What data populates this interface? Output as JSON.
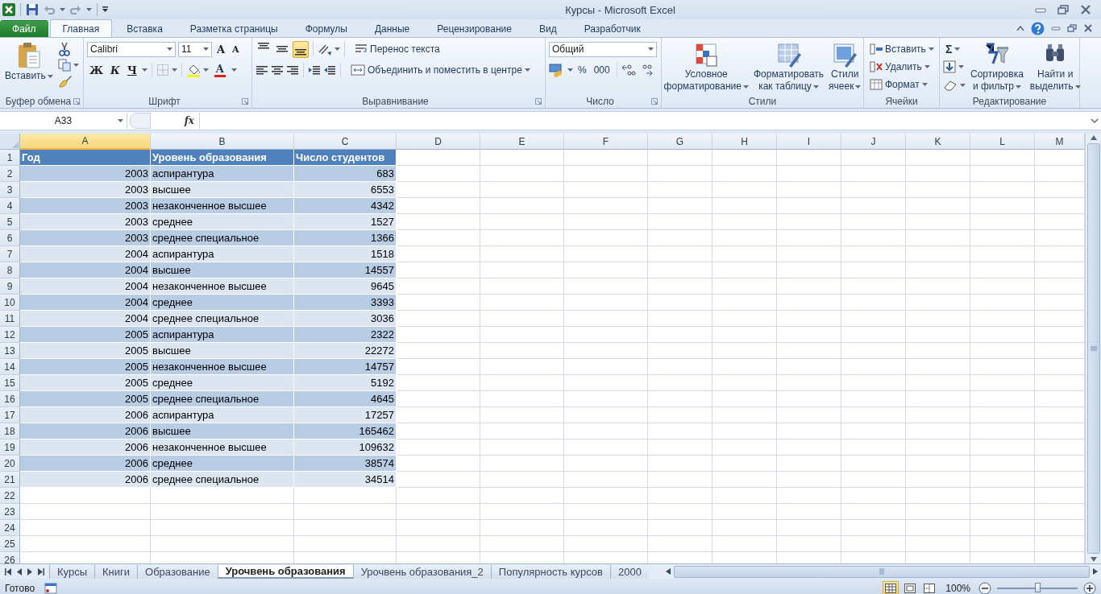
{
  "title_bar": {
    "title": "Курсы  -  Microsoft Excel"
  },
  "ribbon_tabs": [
    {
      "label": "Файл",
      "kind": "file",
      "selected": false
    },
    {
      "label": "Главная",
      "kind": "tab",
      "selected": true
    },
    {
      "label": "Вставка",
      "kind": "tab",
      "selected": false
    },
    {
      "label": "Разметка страницы",
      "kind": "tab",
      "selected": false
    },
    {
      "label": "Формулы",
      "kind": "tab",
      "selected": false
    },
    {
      "label": "Данные",
      "kind": "tab",
      "selected": false
    },
    {
      "label": "Рецензирование",
      "kind": "tab",
      "selected": false
    },
    {
      "label": "Вид",
      "kind": "tab",
      "selected": false
    },
    {
      "label": "Разработчик",
      "kind": "tab",
      "selected": false
    }
  ],
  "ribbon": {
    "clipboard": {
      "label": "Буфер обмена",
      "paste": "Вставить"
    },
    "font": {
      "label": "Шрифт",
      "font_name": "Calibri",
      "font_size": "11",
      "grow_font": "A",
      "shrink_font": "A",
      "bold": "Ж",
      "italic": "К",
      "underline": "Ч",
      "font_color": "A"
    },
    "alignment": {
      "label": "Выравнивание",
      "vertical_align": [
        {
          "selected": false
        },
        {
          "selected": false
        },
        {
          "selected": true
        }
      ],
      "wrap_text": "Перенос текста",
      "merge_center": "Объединить и поместить в центре"
    },
    "number": {
      "label": "Число",
      "format": "Общий",
      "percent": "%",
      "thousands": "000"
    },
    "styles": {
      "label": "Стили",
      "buttons": [
        {
          "lines": [
            "Условное",
            "форматирование"
          ]
        },
        {
          "lines": [
            "Форматировать",
            "как таблицу"
          ]
        },
        {
          "lines": [
            "Стили",
            "ячеек"
          ]
        }
      ]
    },
    "cells": {
      "label": "Ячейки",
      "buttons": [
        "Вставить",
        "Удалить",
        "Формат"
      ]
    },
    "editing": {
      "label": "Редактирование",
      "sum": "Σ",
      "buttons": [
        {
          "lines": [
            "Сортировка",
            "и фильтр"
          ]
        },
        {
          "lines": [
            "Найти и",
            "выделить"
          ]
        }
      ]
    }
  },
  "formula_bar": {
    "name_box": "A33",
    "function_label": "fx"
  },
  "columns": [
    {
      "label": "A",
      "selected": true
    },
    {
      "label": "B",
      "selected": false
    },
    {
      "label": "C",
      "selected": false
    },
    {
      "label": "D",
      "selected": false
    },
    {
      "label": "E",
      "selected": false
    },
    {
      "label": "F",
      "selected": false
    },
    {
      "label": "G",
      "selected": false
    },
    {
      "label": "H",
      "selected": false
    },
    {
      "label": "I",
      "selected": false
    },
    {
      "label": "J",
      "selected": false
    },
    {
      "label": "K",
      "selected": false
    },
    {
      "label": "L",
      "selected": false
    },
    {
      "label": "M",
      "selected": false
    }
  ],
  "rows": [
    {
      "number": "1",
      "kind": "header",
      "cells": [
        "Год",
        "Уровень образования",
        "Число студентов"
      ]
    },
    {
      "number": "2",
      "kind": "data",
      "cells": [
        "2003",
        "аспирантура",
        "683"
      ]
    },
    {
      "number": "3",
      "kind": "data",
      "cells": [
        "2003",
        "высшее",
        "6553"
      ]
    },
    {
      "number": "4",
      "kind": "data",
      "cells": [
        "2003",
        "незаконченное высшее",
        "4342"
      ]
    },
    {
      "number": "5",
      "kind": "data",
      "cells": [
        "2003",
        "среднее",
        "1527"
      ]
    },
    {
      "number": "6",
      "kind": "data",
      "cells": [
        "2003",
        "среднее специальное",
        "1366"
      ]
    },
    {
      "number": "7",
      "kind": "data",
      "cells": [
        "2004",
        "аспирантура",
        "1518"
      ]
    },
    {
      "number": "8",
      "kind": "data",
      "cells": [
        "2004",
        "высшее",
        "14557"
      ]
    },
    {
      "number": "9",
      "kind": "data",
      "cells": [
        "2004",
        "незаконченное высшее",
        "9645"
      ]
    },
    {
      "number": "10",
      "kind": "data",
      "cells": [
        "2004",
        "среднее",
        "3393"
      ]
    },
    {
      "number": "11",
      "kind": "data",
      "cells": [
        "2004",
        "среднее специальное",
        "3036"
      ]
    },
    {
      "number": "12",
      "kind": "data",
      "cells": [
        "2005",
        "аспирантура",
        "2322"
      ]
    },
    {
      "number": "13",
      "kind": "data",
      "cells": [
        "2005",
        "высшее",
        "22272"
      ]
    },
    {
      "number": "14",
      "kind": "data",
      "cells": [
        "2005",
        "незаконченное высшее",
        "14757"
      ]
    },
    {
      "number": "15",
      "kind": "data",
      "cells": [
        "2005",
        "среднее",
        "5192"
      ]
    },
    {
      "number": "16",
      "kind": "data",
      "cells": [
        "2005",
        "среднее специальное",
        "4645"
      ]
    },
    {
      "number": "17",
      "kind": "data",
      "cells": [
        "2006",
        "аспирантура",
        "17257"
      ]
    },
    {
      "number": "18",
      "kind": "data",
      "cells": [
        "2006",
        "высшее",
        "165462"
      ]
    },
    {
      "number": "19",
      "kind": "data",
      "cells": [
        "2006",
        "незаконченное высшее",
        "109632"
      ]
    },
    {
      "number": "20",
      "kind": "data",
      "cells": [
        "2006",
        "среднее",
        "38574"
      ]
    },
    {
      "number": "21",
      "kind": "data",
      "cells": [
        "2006",
        "среднее специальное",
        "34514"
      ]
    },
    {
      "number": "22",
      "kind": "empty"
    },
    {
      "number": "23",
      "kind": "empty"
    },
    {
      "number": "24",
      "kind": "empty"
    },
    {
      "number": "25",
      "kind": "empty"
    },
    {
      "number": "26",
      "kind": "empty"
    }
  ],
  "sheet_tabs": [
    {
      "label": "Курсы",
      "selected": false
    },
    {
      "label": "Книги",
      "selected": false
    },
    {
      "label": "Образование",
      "selected": false
    },
    {
      "label": "Урочвень образования",
      "selected": true
    },
    {
      "label": "Урочвень образования_2",
      "selected": false
    },
    {
      "label": "Популярность курсов",
      "selected": false
    },
    {
      "label": "2000",
      "selected": false
    }
  ],
  "status_bar": {
    "status": "Готово",
    "views": [
      {
        "selected": true
      },
      {
        "selected": false
      },
      {
        "selected": false
      }
    ],
    "zoom": "100%",
    "zoom_slider": {
      "level": 0.5
    }
  }
}
